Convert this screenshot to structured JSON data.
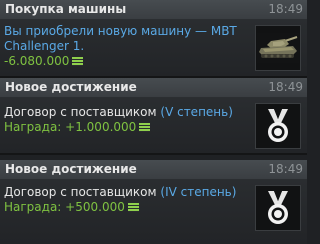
{
  "notifications": [
    {
      "title": "Покупка машины",
      "time": "18:49",
      "line1_prefix": "Вы приобрели новую машину — MBT",
      "line2": "Challenger 1.",
      "amount": "-6.080.000",
      "icon": "tank-icon"
    },
    {
      "title": "Новое достижение",
      "time": "18:49",
      "contract_prefix": "Договор с поставщиком ",
      "degree": "(V степень)",
      "reward_prefix": "Награда: ",
      "reward_value": "+1.000.000",
      "icon": "medal-icon"
    },
    {
      "title": "Новое достижение",
      "time": "18:49",
      "contract_prefix": "Договор с поставщиком ",
      "degree": "(IV степень)",
      "reward_prefix": "Награда: ",
      "reward_value": "+500.000",
      "icon": "medal-icon"
    }
  ],
  "colors": {
    "header_text": "#e8e8e8",
    "time_text": "#8e9396",
    "blue_text": "#5aa9e6",
    "green_text": "#7fc241",
    "background": "#1f2124"
  }
}
